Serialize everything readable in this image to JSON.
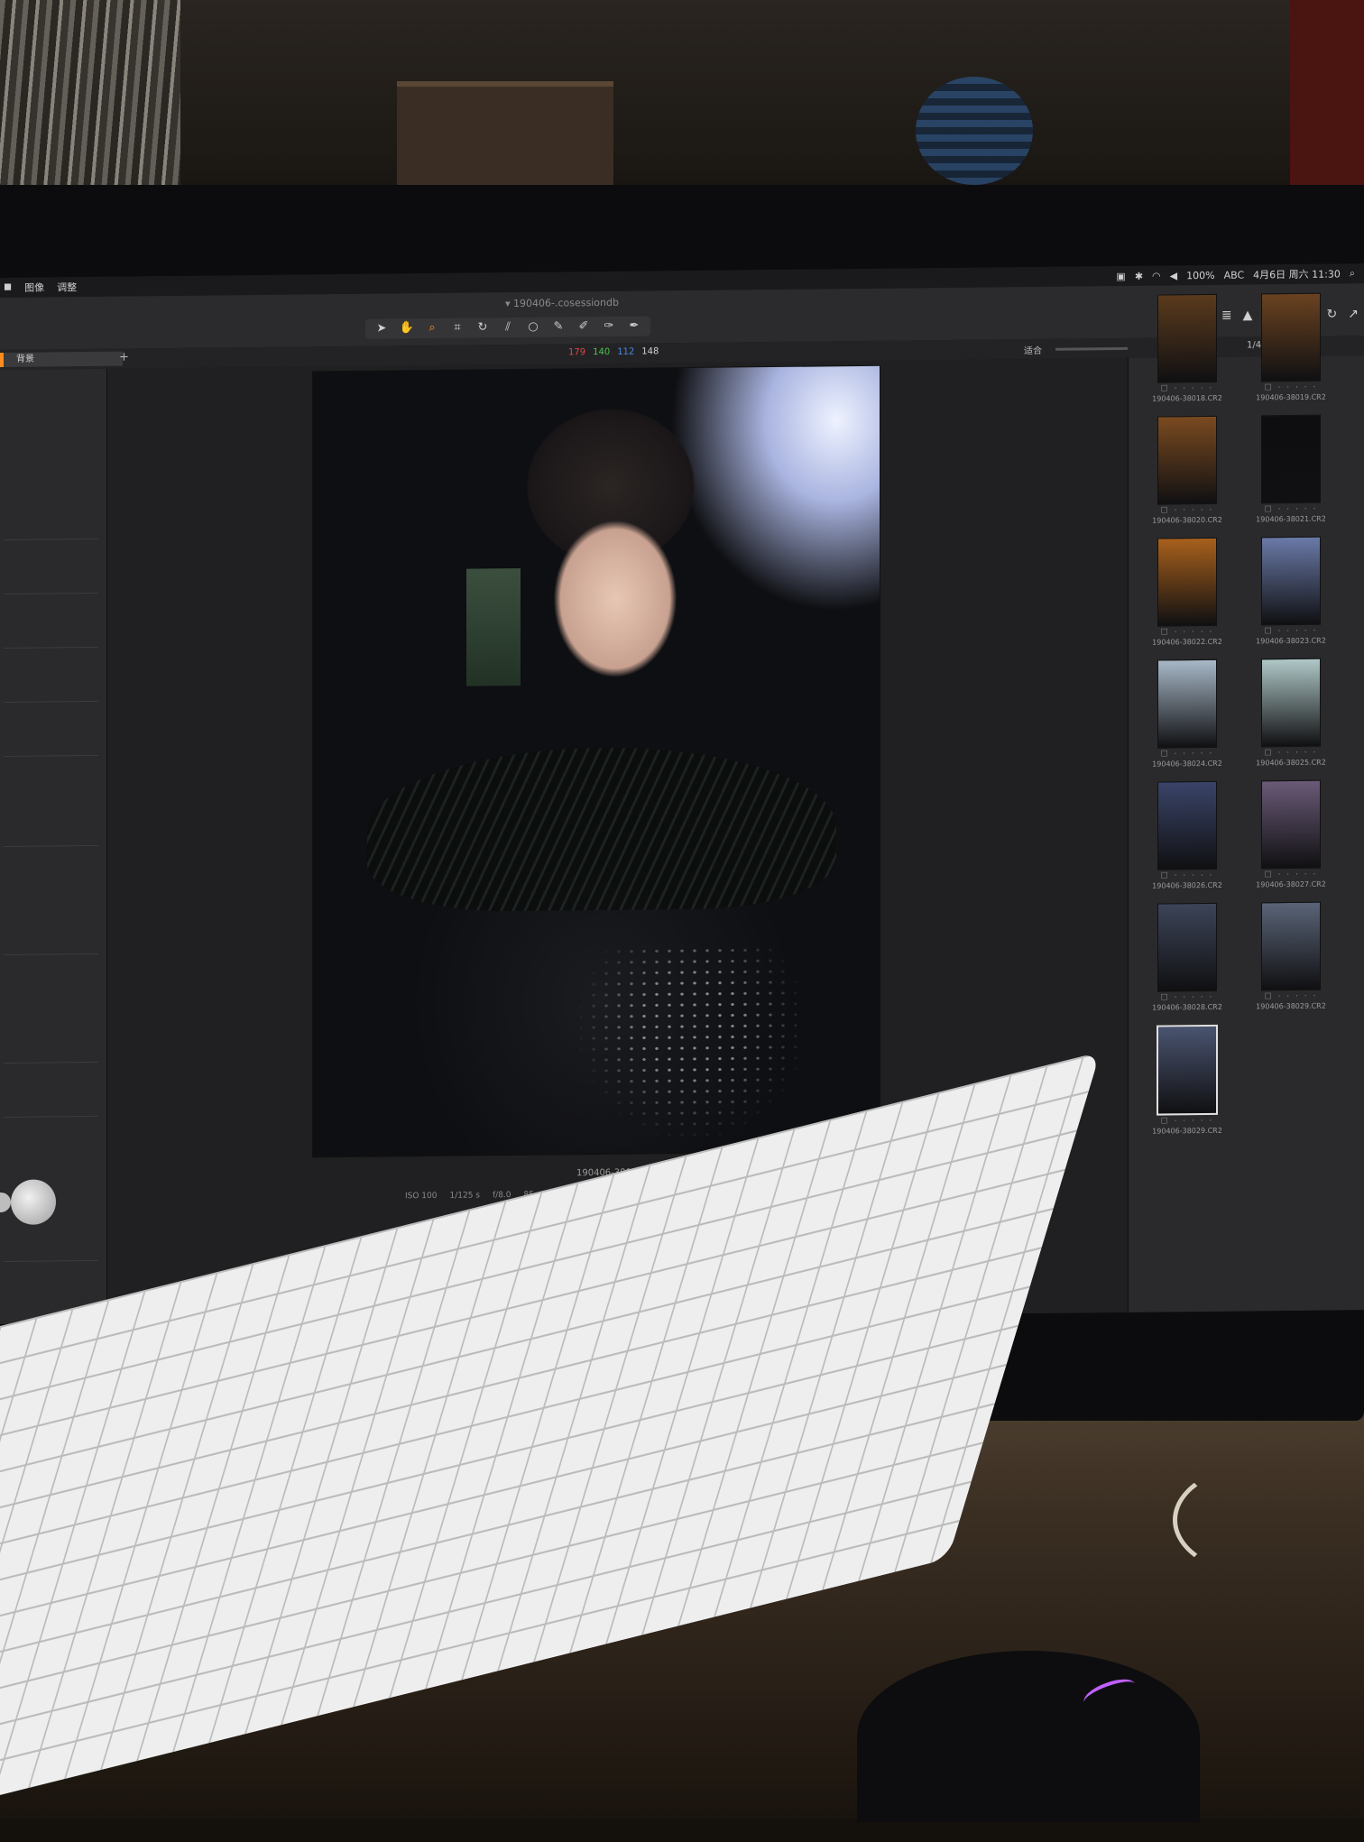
{
  "menubar": {
    "items": [
      "图像",
      "调整"
    ],
    "status": [
      "100%",
      "ABC",
      "4月6日 周六 11:30"
    ]
  },
  "window": {
    "title": "190406-.cosessiondb"
  },
  "toolbar": {
    "tool_icons": [
      "pointer-icon",
      "hand-icon",
      "loupe-icon",
      "crop-icon",
      "rotate-icon",
      "keystone-icon",
      "spot-icon",
      "brush-icon",
      "eraser-icon",
      "gradient-icon",
      "picker-icon"
    ],
    "active_tool": "loupe-icon"
  },
  "counts": {
    "red": "179",
    "green": "140",
    "blue": "112",
    "white": "148"
  },
  "subbar": {
    "layer_label": "背景",
    "zoom_label": "适合",
    "page_count": "1/455"
  },
  "viewer": {
    "filename": "190406-38029.CR2",
    "meta": [
      "ISO 100",
      "1/125 s",
      "f/8.0",
      "85 mm"
    ]
  },
  "browser": {
    "thumbs": [
      {
        "name": "190406-38018.CR2",
        "tone": "#5a3a1c"
      },
      {
        "name": "190406-38019.CR2",
        "tone": "#6a4220"
      },
      {
        "name": "190406-38020.CR2",
        "tone": "#7a4a20"
      },
      {
        "name": "190406-38021.CR2",
        "tone": "#0e0e10"
      },
      {
        "name": "190406-38022.CR2",
        "tone": "#a8601c"
      },
      {
        "name": "190406-38023.CR2",
        "tone": "#6a7aa8"
      },
      {
        "name": "190406-38024.CR2",
        "tone": "#a8b8c8"
      },
      {
        "name": "190406-38025.CR2",
        "tone": "#b0c8c8"
      },
      {
        "name": "190406-38026.CR2",
        "tone": "#3a4468"
      },
      {
        "name": "190406-38027.CR2",
        "tone": "#6a5a78"
      },
      {
        "name": "190406-38028.CR2",
        "tone": "#3c4458"
      },
      {
        "name": "190406-38029.CR2",
        "tone": "#5a6478"
      },
      {
        "name": "190406-38029.CR2",
        "tone": "#4a5470"
      }
    ],
    "stars": "☐ · · · · ·"
  },
  "dock": {
    "icon_colors": [
      "#3a78d8",
      "#4a90e2",
      "#5a6ad0",
      "#d04a3a",
      "#e8b040",
      "#2aa0e0",
      "#4ab04a",
      "#1a5ab8",
      "#1a6ad8",
      "#cc3a3a",
      "#d8a830",
      "#b0b0b0",
      "#e0e0e0",
      "#f0a0c0",
      "#3a90e0",
      "#5aa8f0",
      "#909090"
    ]
  }
}
